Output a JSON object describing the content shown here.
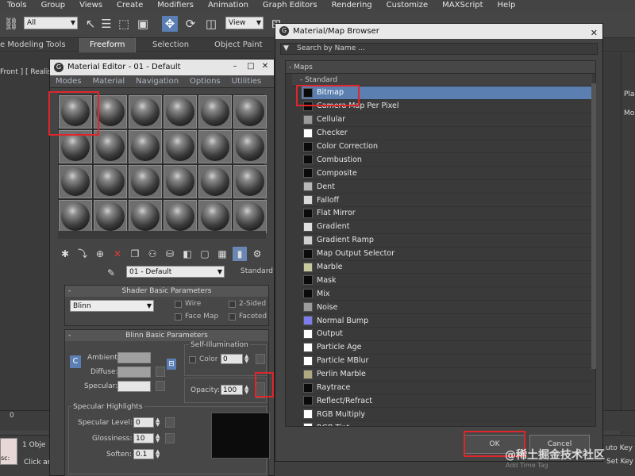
{
  "app": {
    "menubar": [
      "Tools",
      "Group",
      "Views",
      "Create",
      "Modifiers",
      "Animation",
      "Graph Editors",
      "Rendering",
      "Customize",
      "MAXScript",
      "Help"
    ],
    "selection_filter": "All",
    "view_select": "View",
    "ribbon": {
      "left": "e Modeling Tools",
      "tabs": [
        "Freeform",
        "Selection",
        "Object Paint"
      ]
    },
    "viewport_label": "Front ] [ Realist",
    "timeline_zero": "0",
    "status_objects": "1 Obje",
    "status_hint": "Click and drag to select and move objects",
    "left_box_text": "sc:",
    "right_panel": {
      "top": "Pla",
      "second": "Mo"
    },
    "status_right": {
      "auto_key": "uto Key",
      "set_key": "Set Key",
      "add_time_tag": "Add Time Tag"
    },
    "watermark": "@稀土掘金技术社区"
  },
  "material_editor": {
    "title": "Material Editor - 01 - Default",
    "menu": [
      "Modes",
      "Material",
      "Navigation",
      "Options",
      "Utilities"
    ],
    "slots": 24,
    "material_name": "01 - Default",
    "material_type": "Standard",
    "shader_basic": {
      "heading": "Shader Basic Parameters",
      "shader": "Blinn",
      "wire": "Wire",
      "two_sided": "2-Sided",
      "face_map": "Face Map",
      "faceted": "Faceted"
    },
    "blinn_basic": {
      "heading": "Blinn Basic Parameters",
      "ambient": "Ambient:",
      "diffuse": "Diffuse:",
      "specular": "Specular:",
      "self_illum": "Self-Illumination",
      "color": "Color",
      "color_value": "0",
      "opacity": "Opacity:",
      "opacity_value": "100"
    },
    "specular_highlights": {
      "heading": "Specular Highlights",
      "specular_level": "Specular Level:",
      "specular_level_value": "0",
      "glossiness": "Glossiness:",
      "glossiness_value": "10",
      "soften": "Soften:",
      "soften_value": "0.1"
    }
  },
  "map_browser": {
    "title": "Material/Map Browser",
    "search_placeholder": "Search by Name ...",
    "group": "- Maps",
    "subgroup": "- Standard",
    "items": [
      {
        "label": "Bitmap",
        "icon": "#0a0a0a",
        "selected": true
      },
      {
        "label": "Camera Map Per Pixel",
        "icon": "#0a0a0a"
      },
      {
        "label": "Cellular",
        "icon": "#9a9a9a"
      },
      {
        "label": "Checker",
        "icon": "#ffffff"
      },
      {
        "label": "Color Correction",
        "icon": "#0a0a0a"
      },
      {
        "label": "Combustion",
        "icon": "#0a0a0a"
      },
      {
        "label": "Composite",
        "icon": "#0a0a0a"
      },
      {
        "label": "Dent",
        "icon": "#b8b8b8"
      },
      {
        "label": "Falloff",
        "icon": "#d8d8d8"
      },
      {
        "label": "Flat Mirror",
        "icon": "#0a0a0a"
      },
      {
        "label": "Gradient",
        "icon": "#e0e0e0"
      },
      {
        "label": "Gradient Ramp",
        "icon": "#cfcfcf"
      },
      {
        "label": "Map Output Selector",
        "icon": "#0a0a0a"
      },
      {
        "label": "Marble",
        "icon": "#c9c9a0"
      },
      {
        "label": "Mask",
        "icon": "#0a0a0a"
      },
      {
        "label": "Mix",
        "icon": "#0a0a0a"
      },
      {
        "label": "Noise",
        "icon": "#9c9c9c"
      },
      {
        "label": "Normal Bump",
        "icon": "#7d7df0"
      },
      {
        "label": "Output",
        "icon": "#ffffff"
      },
      {
        "label": "Particle Age",
        "icon": "#ffffff"
      },
      {
        "label": "Particle MBlur",
        "icon": "#ffffff"
      },
      {
        "label": "Perlin Marble",
        "icon": "#b0a880"
      },
      {
        "label": "Raytrace",
        "icon": "#0a0a0a"
      },
      {
        "label": "Reflect/Refract",
        "icon": "#0a0a0a"
      },
      {
        "label": "RGB Multiply",
        "icon": "#ffffff"
      },
      {
        "label": "RGB Tint",
        "icon": "#ffffff"
      }
    ],
    "ok": "OK",
    "cancel": "Cancel"
  },
  "colors": {
    "annotation_red": "#e0262b",
    "selection_blue": "#5a7fb0"
  }
}
